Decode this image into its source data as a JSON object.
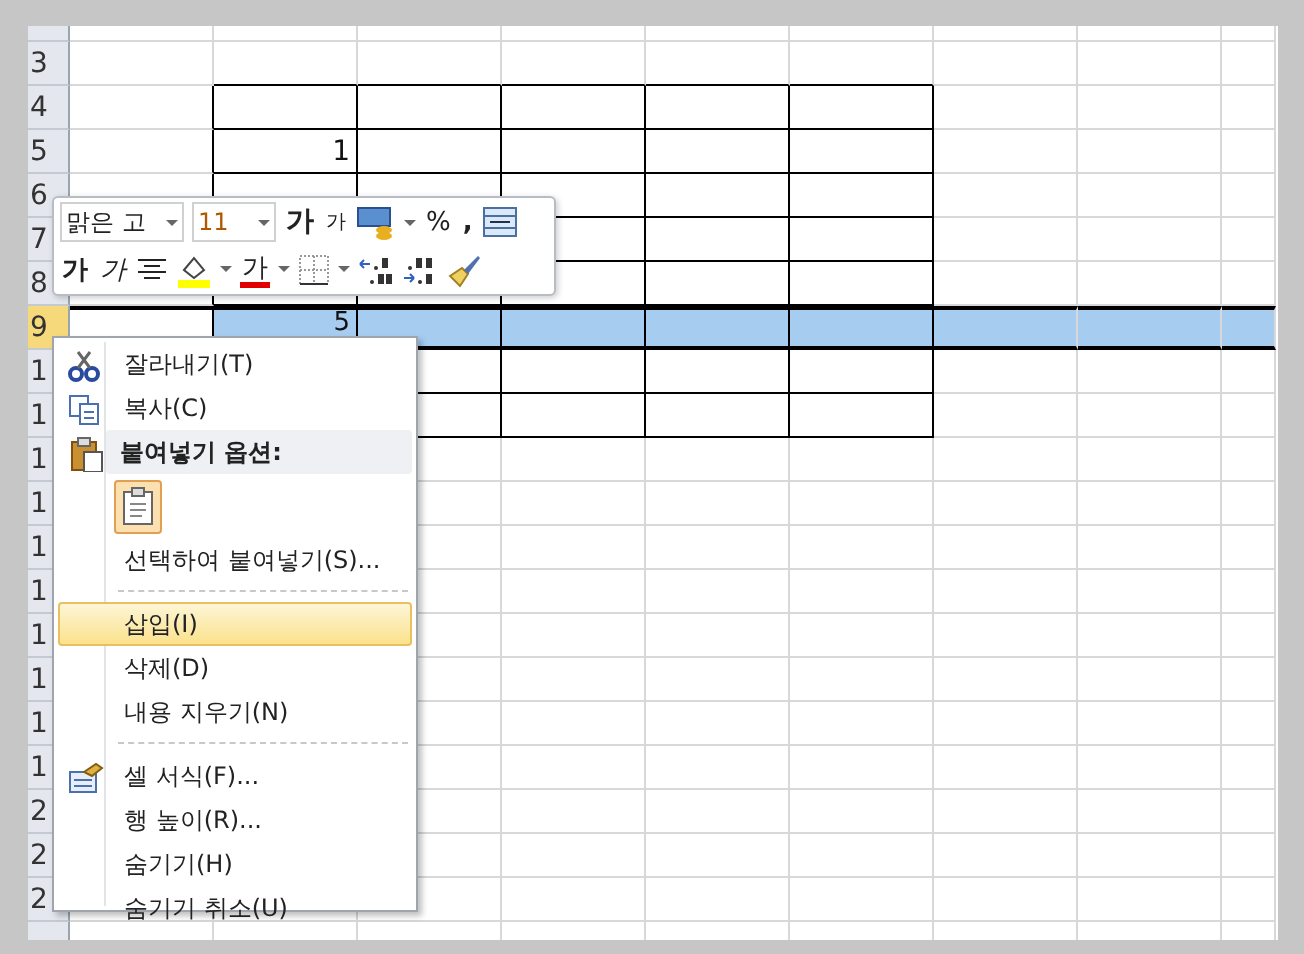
{
  "sheet": {
    "rows": [
      {
        "selected": false,
        "bordered": false
      },
      {
        "label": "3",
        "selected": false,
        "bordered": false
      },
      {
        "label": "4",
        "selected": false,
        "bordered": true
      },
      {
        "label": "5",
        "selected": false,
        "bordered": true,
        "column_2": "1"
      },
      {
        "label": "6",
        "selected": false,
        "bordered": true
      },
      {
        "label": "7",
        "selected": false,
        "bordered": true
      },
      {
        "label": "8",
        "selected": false,
        "bordered": true
      },
      {
        "label": "9",
        "selected": true,
        "bordered": true,
        "column_2": "5"
      },
      {
        "label": "1",
        "selected": false,
        "bordered": true
      },
      {
        "label": "1",
        "selected": false,
        "bordered": true
      },
      {
        "label": "1",
        "selected": false,
        "bordered": false
      },
      {
        "label": "1",
        "selected": false,
        "bordered": false
      },
      {
        "label": "1",
        "selected": false,
        "bordered": false
      },
      {
        "label": "1",
        "selected": false,
        "bordered": false
      },
      {
        "label": "1",
        "selected": false,
        "bordered": false
      },
      {
        "label": "1",
        "selected": false,
        "bordered": false
      },
      {
        "label": "1",
        "selected": false,
        "bordered": false
      },
      {
        "label": "1",
        "selected": false,
        "bordered": false
      },
      {
        "label": "2",
        "selected": false,
        "bordered": false
      },
      {
        "label": "2",
        "selected": false,
        "bordered": false
      },
      {
        "label": "2",
        "selected": false,
        "bordered": false
      },
      {
        "selected": false,
        "bordered": false
      }
    ]
  },
  "mini_toolbar": {
    "font_name": "맑은 고",
    "font_size": "11",
    "grow_font": "가",
    "shrink_font": "가",
    "percent": "%",
    "comma": ",",
    "bold": "가",
    "italic": "가",
    "font_color": "가"
  },
  "context_menu": {
    "items": [
      {
        "kind": "cut",
        "label": "잘라내기(T)",
        "selected": false
      },
      {
        "kind": "copy",
        "label": "복사(C)",
        "selected": false
      },
      {
        "kind": "header",
        "label": "붙여넣기 옵션:"
      },
      {
        "kind": "paste"
      },
      {
        "kind": "item",
        "label": "선택하여 붙여넣기(S)...",
        "selected": false
      },
      {
        "kind": "separator"
      },
      {
        "kind": "item",
        "label": "삽입(I)",
        "selected": true
      },
      {
        "kind": "item",
        "label": "삭제(D)",
        "selected": false
      },
      {
        "kind": "item",
        "label": "내용 지우기(N)",
        "selected": false
      },
      {
        "kind": "separator"
      },
      {
        "kind": "format",
        "label": "셀 서식(F)...",
        "selected": false
      },
      {
        "kind": "item",
        "label": "행 높이(R)...",
        "selected": false
      },
      {
        "kind": "item",
        "label": "숨기기(H)",
        "selected": false
      },
      {
        "kind": "item",
        "label": "숨기기 취소(U)",
        "selected": false
      }
    ]
  }
}
